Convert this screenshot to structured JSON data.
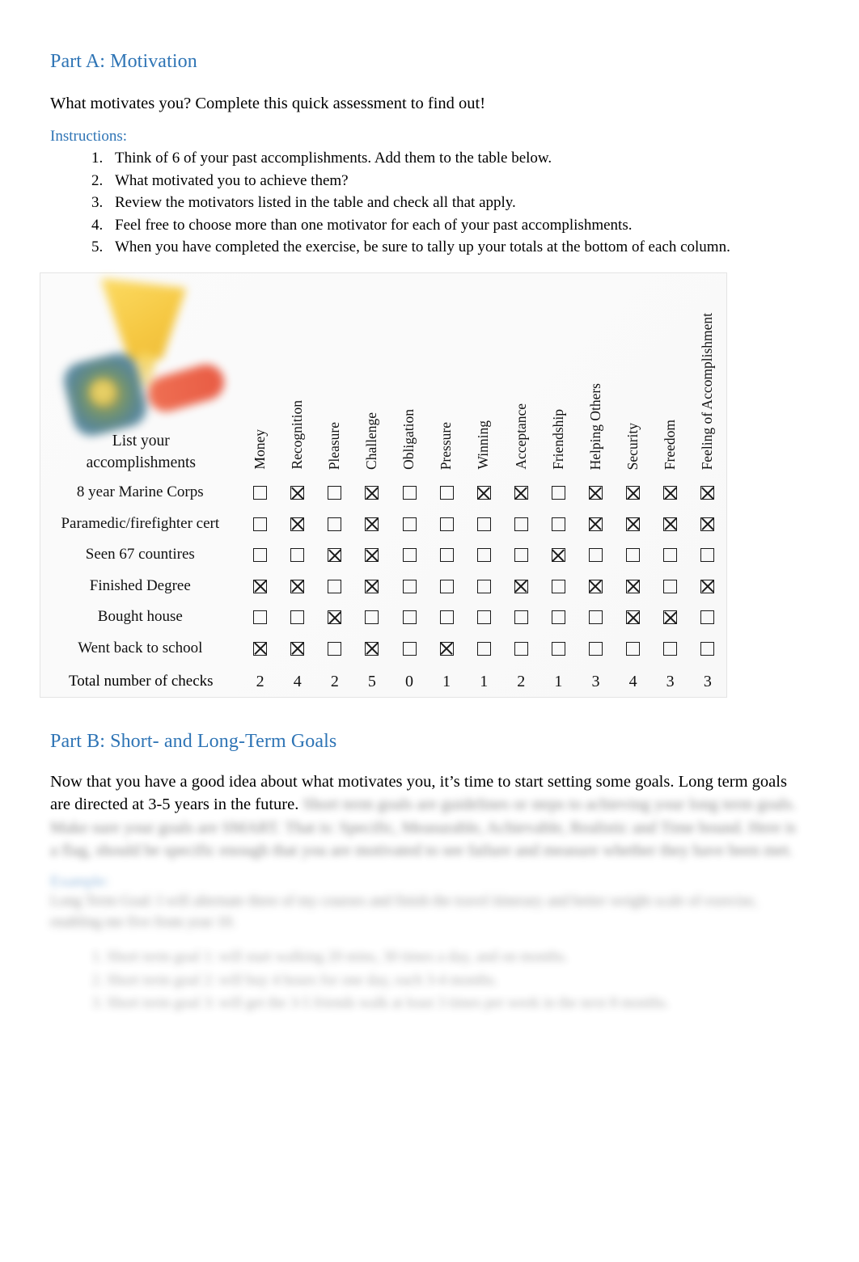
{
  "document": {
    "part_a": {
      "heading": "Part A: Motivation",
      "intro": "What motivates you? Complete this quick assessment to find out!",
      "instructions_label": "Instructions:",
      "instructions": [
        "Think of 6 of your past accomplishments. Add them to the table below.",
        "What motivated you to achieve them?",
        "Review the motivators listed in the table and check all that apply.",
        "Feel free to choose more than one motivator for each of your past accomplishments.",
        "When you have completed the exercise, be sure to tally up your totals at the bottom of each column."
      ]
    },
    "table": {
      "corner_caption_line1": "List your",
      "corner_caption_line2": "accomplishments",
      "corner_image": "trophy-medal-ribbon-graphic",
      "columns": [
        "Money",
        "Recognition",
        "Pleasure",
        "Challenge",
        "Obligation",
        "Pressure",
        "Winning",
        "Acceptance",
        "Friendship",
        "Helping Others",
        "Security",
        "Freedom",
        "Feeling of Accomplishment"
      ],
      "rows": [
        {
          "label": "8 year Marine Corps",
          "checks": [
            false,
            true,
            false,
            true,
            false,
            false,
            true,
            true,
            false,
            true,
            true,
            true,
            true
          ]
        },
        {
          "label": "Paramedic/firefighter cert",
          "checks": [
            false,
            true,
            false,
            true,
            false,
            false,
            false,
            false,
            false,
            true,
            true,
            true,
            true
          ]
        },
        {
          "label": "Seen 67 countires",
          "checks": [
            false,
            false,
            true,
            true,
            false,
            false,
            false,
            false,
            true,
            false,
            false,
            false,
            false
          ]
        },
        {
          "label": "Finished Degree",
          "checks": [
            true,
            true,
            false,
            true,
            false,
            false,
            false,
            true,
            false,
            true,
            true,
            false,
            true
          ]
        },
        {
          "label": "Bought house",
          "checks": [
            false,
            false,
            true,
            false,
            false,
            false,
            false,
            false,
            false,
            false,
            true,
            true,
            false
          ]
        },
        {
          "label": "Went back to school",
          "checks": [
            true,
            true,
            false,
            true,
            false,
            true,
            false,
            false,
            false,
            false,
            false,
            false,
            false
          ]
        }
      ],
      "totals_label": "Total number of checks",
      "totals": [
        2,
        4,
        2,
        5,
        0,
        1,
        1,
        2,
        1,
        3,
        4,
        3,
        3
      ]
    },
    "part_b": {
      "heading": "Part B: Short- and Long-Term Goals",
      "paragraph_visible": "Now that you have a good idea about what motivates you, it’s time to start setting some goals. Long term goals are directed at 3-5 years in the future.",
      "paragraph_blurred_line1": "Short term goals are guidelines or steps to achieving your long term goals. Make sure your goals are SMART. That is: Specific, Measurable, Achievable,",
      "paragraph_blurred_line2": "Realistic and Time bound. Here is a flag, should be specific enough that you are motivated to see failure and measure whether they have been met.",
      "blurred_heading": "Example:",
      "blurred_sub_line1": "Long Term Goal: I will alternate three of my courses and finish the travel itinerary and better weight scale of exercise, enabling me five from year 10.",
      "blurred_list": [
        "Short term goal 1: will start walking 20 mins, 30 times a day, and on months.",
        "Short term goal 2: will buy 4 hours for one day, each 3-4 months.",
        "Short term goal 3: will get the 3-5 friends walk at least 3 times per week in the next 8 months."
      ]
    }
  },
  "colors": {
    "heading_blue": "#2E74B5",
    "body_black": "#000000",
    "table_bg": "#FAFAFA",
    "checkbox_border": "#1A1A1A"
  }
}
